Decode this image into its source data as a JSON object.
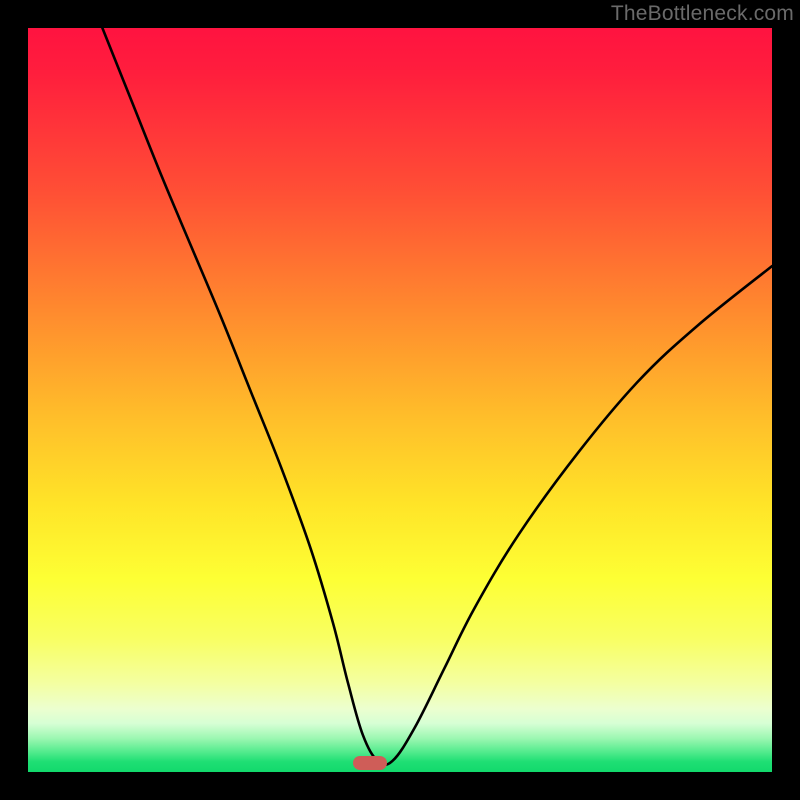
{
  "watermark": "TheBottleneck.com",
  "marker": {
    "x_pct": 46.0,
    "y_pct": 98.8
  },
  "chart_data": {
    "type": "line",
    "title": "",
    "xlabel": "",
    "ylabel": "",
    "xlim": [
      0,
      100
    ],
    "ylim": [
      0,
      100
    ],
    "grid": false,
    "legend": false,
    "series": [
      {
        "name": "bottleneck-curve",
        "x": [
          10,
          14,
          18,
          22,
          26,
          30,
          34,
          38,
          41,
          43,
          45,
          47,
          49,
          52,
          56,
          60,
          66,
          74,
          82,
          90,
          100
        ],
        "y": [
          100,
          90,
          80,
          70.5,
          61,
          51,
          41,
          30,
          20,
          12,
          5,
          1.5,
          1.5,
          6,
          14,
          22,
          32,
          43,
          52.5,
          60,
          68
        ]
      }
    ],
    "annotations": [
      {
        "type": "marker",
        "shape": "pill",
        "color": "#cf5d58",
        "x": 46,
        "y": 1.2
      }
    ],
    "background_gradient": {
      "orientation": "vertical",
      "stops": [
        {
          "pct": 0,
          "color": "#ff1340"
        },
        {
          "pct": 22,
          "color": "#ff4f35"
        },
        {
          "pct": 52,
          "color": "#ffbd2a"
        },
        {
          "pct": 74,
          "color": "#fdff34"
        },
        {
          "pct": 93.5,
          "color": "#d6ffd4"
        },
        {
          "pct": 100,
          "color": "#12d96c"
        }
      ]
    }
  }
}
